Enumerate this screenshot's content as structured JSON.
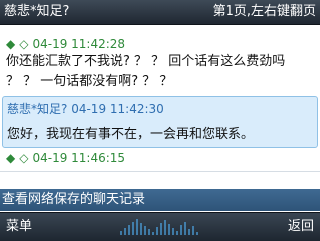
{
  "header": {
    "contact": "慈悲*知足?",
    "page_info": "第1页,左右键翻页"
  },
  "messages": [
    {
      "id": "m1",
      "icons": [
        "filled-diamond",
        "hollow-diamond"
      ],
      "time": "04-19 11:42:28",
      "lines": [
        "你还能汇款了不我说? ？ ？ 回个话有这么费劲吗",
        "？ ？ 一句话都没有啊? ？ ？"
      ]
    },
    {
      "id": "m2",
      "sender": "慈悲*知足?",
      "time": "04-19 11:42:30",
      "text": "您好，我现在有事不在，一会再和您联系。"
    },
    {
      "id": "m3",
      "icons": [
        "filled-diamond",
        "hollow-diamond"
      ],
      "time": "04-19 11:46:15"
    }
  ],
  "notice": "查看网络保存的聊天记录",
  "softkeys": {
    "left": "菜单",
    "right": "返回"
  }
}
